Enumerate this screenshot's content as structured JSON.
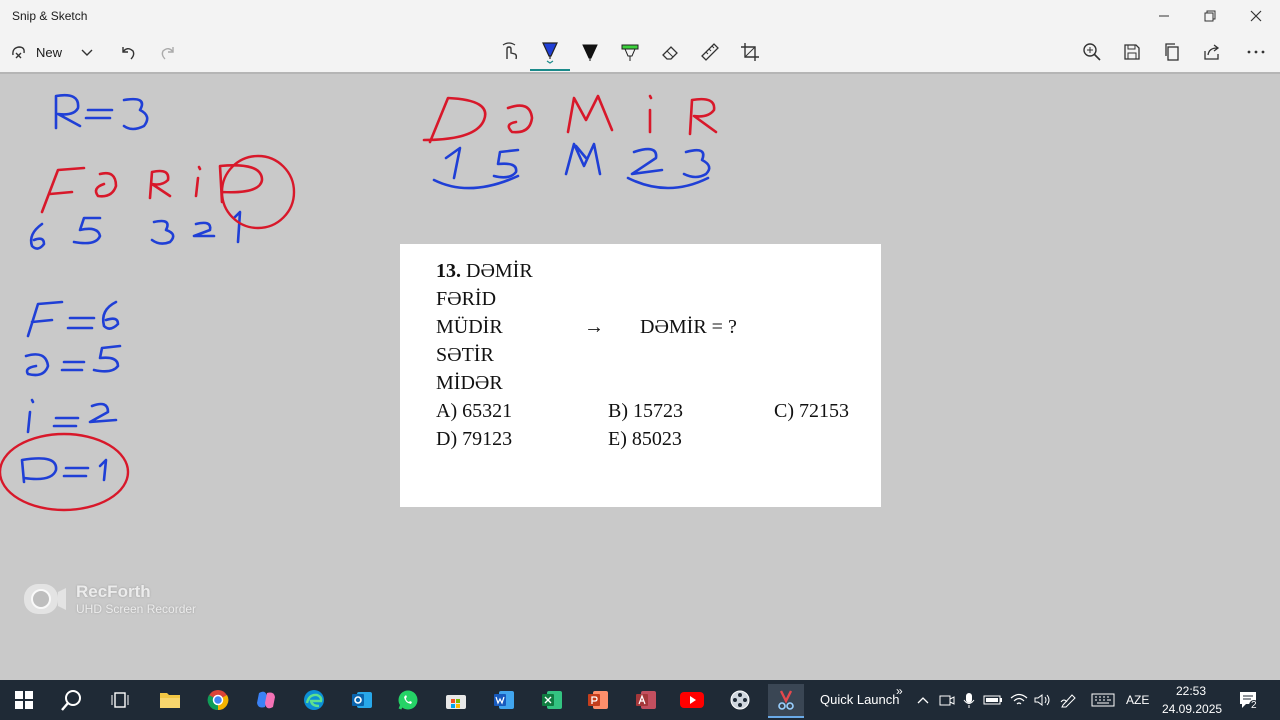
{
  "window": {
    "title": "Snip & Sketch",
    "minimize_icon": "minimize-icon",
    "restore_icon": "restore-icon",
    "close_icon": "close-icon"
  },
  "toolbar": {
    "new_label": "New",
    "tools": [
      "touch-writing-icon",
      "ballpoint-pen-icon",
      "pencil-icon",
      "highlighter-icon",
      "eraser-icon",
      "ruler-icon",
      "crop-icon"
    ],
    "right_tools": [
      "zoom-icon",
      "save-icon",
      "copy-icon",
      "share-icon",
      "more-icon"
    ],
    "active_pen_color": "#1f3fd6",
    "accent": "#1a8a8a"
  },
  "worksheet": {
    "number": "13.",
    "word1": "DƏMİR",
    "words": [
      "FƏRİD",
      "MÜDİR",
      "SƏTİR",
      "MİDƏR"
    ],
    "arrow": "→",
    "question": "DƏMİR = ?",
    "options": {
      "a": "A) 65321",
      "b": "B) 15723",
      "c": "C) 72153",
      "d": "D) 79123",
      "e": "E) 85023"
    }
  },
  "ink_colors": {
    "blue": "#1f3fd6",
    "red": "#d8182a"
  },
  "watermark": {
    "title": "RecForth",
    "subtitle": "UHD Screen Recorder"
  },
  "taskbar": {
    "quick_launch": "Quick Launch",
    "chevron": "»",
    "language": "AZE",
    "time": "22:53",
    "date": "24.09.2025",
    "notification_count": "2"
  }
}
